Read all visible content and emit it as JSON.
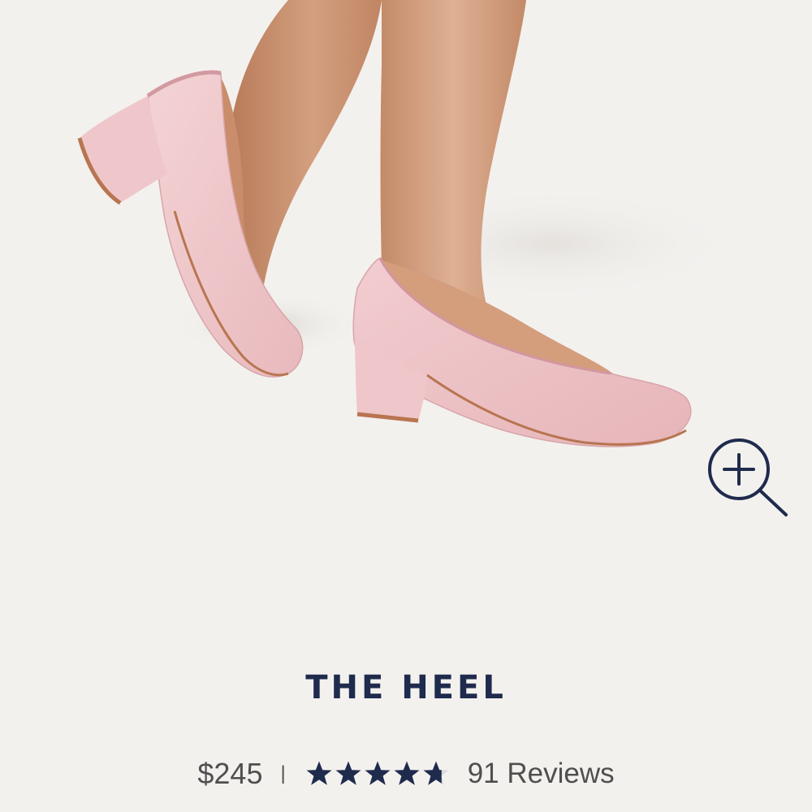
{
  "product": {
    "title": "THE HEEL",
    "price": "$245",
    "separator": "|",
    "rating": 4.7,
    "rating_max": 5,
    "reviews_label": "91 Reviews",
    "image_description_icon": "zoom-in-icon"
  },
  "colors": {
    "background": "#f3f1ee",
    "title": "#1f2b4d",
    "star": "#1f2b4d",
    "text_muted": "#4f4f4f",
    "shoe": "#f0c9cc"
  }
}
